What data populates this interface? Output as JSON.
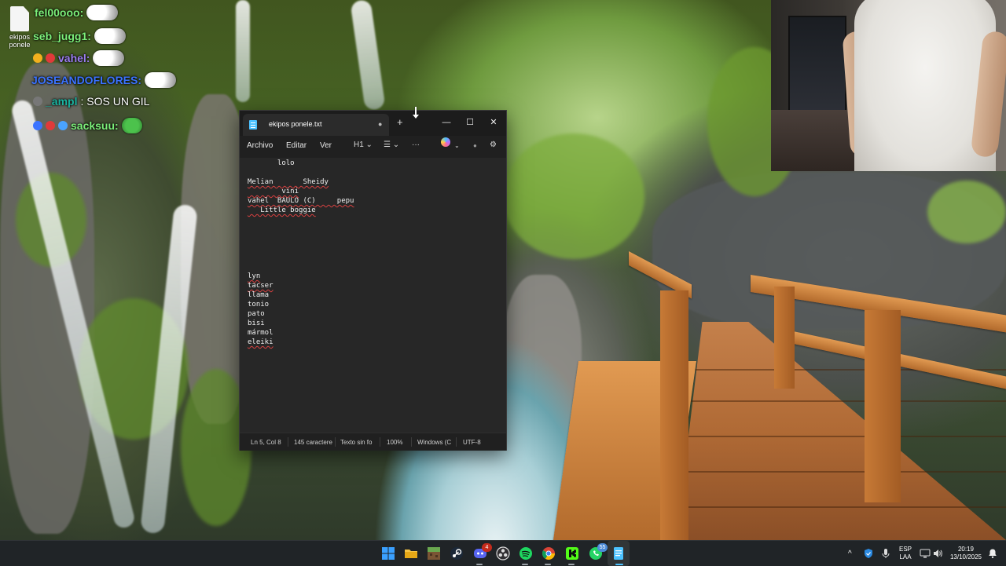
{
  "desktop": {
    "icon_label": "ekipos ponele"
  },
  "chat": [
    {
      "name": "fel00ooo:",
      "message": "",
      "color": "#7cf07a"
    },
    {
      "name": "seb_jugg1:",
      "message": "",
      "color": "#7cf07a"
    },
    {
      "name": "vahel:",
      "message": "",
      "color": "#9b7df0"
    },
    {
      "name": "JOSEANDOFLORES:",
      "message": "",
      "color": "#3b73ff"
    },
    {
      "name": "_ampl",
      "message": ": SOS UN GIL",
      "color": "#19b4a0"
    },
    {
      "name": "sacksuu:",
      "message": "",
      "color": "#7cf07a"
    }
  ],
  "notepad": {
    "tab_title": "ekipos ponele.txt",
    "new_tab_symbol": "+",
    "window_buttons": {
      "minimize": "—",
      "maximize": "☐",
      "close": "✕"
    },
    "menu": {
      "file": "Archivo",
      "edit": "Editar",
      "view": "Ver"
    },
    "toolbar": {
      "heading": "H1 ⌄",
      "list": "☰ ⌄",
      "more": "···",
      "copilot_chevron": "⌄",
      "account": "●",
      "settings": "⚙"
    },
    "lines": [
      "       lolo",
      "",
      "Melian       Sheidy",
      "        vini",
      "vahel  BAULO (C)     pepu",
      "   Little boggie",
      "lyn",
      "tacser",
      "llama",
      "tonio",
      "pato",
      "bisi",
      "mármol",
      "eleiki"
    ],
    "status": {
      "position": "Ln 5, Col 8",
      "chars": "145 caractere",
      "format": "Texto sin fo",
      "zoom": "100%",
      "line_ending": "Windows (C",
      "encoding": "UTF-8"
    }
  },
  "taskbar": {
    "apps": [
      {
        "icon": "windows-start-icon",
        "color": "#3aa0ff"
      },
      {
        "icon": "file-explorer-icon",
        "color": "#f6c444"
      },
      {
        "icon": "minecraft-icon",
        "color": "#6aa84f"
      },
      {
        "icon": "steam-icon",
        "color": "#1b2838"
      },
      {
        "icon": "discord-icon",
        "color": "#5865f2",
        "badge": "4"
      },
      {
        "icon": "obs-icon",
        "color": "#302e31"
      },
      {
        "icon": "spotify-icon",
        "color": "#1ed760"
      },
      {
        "icon": "chrome-icon",
        "color": "#fbbc05"
      },
      {
        "icon": "kick-icon",
        "color": "#53fc18"
      },
      {
        "icon": "whatsapp-icon",
        "color": "#25d366",
        "badge": "55"
      },
      {
        "icon": "notepad-icon",
        "color": "#4cc2ff"
      }
    ],
    "tray": {
      "overflow": "^",
      "language_top": "ESP",
      "language_bottom": "LAA",
      "time": "20:19",
      "date": "13/10/2025"
    }
  }
}
